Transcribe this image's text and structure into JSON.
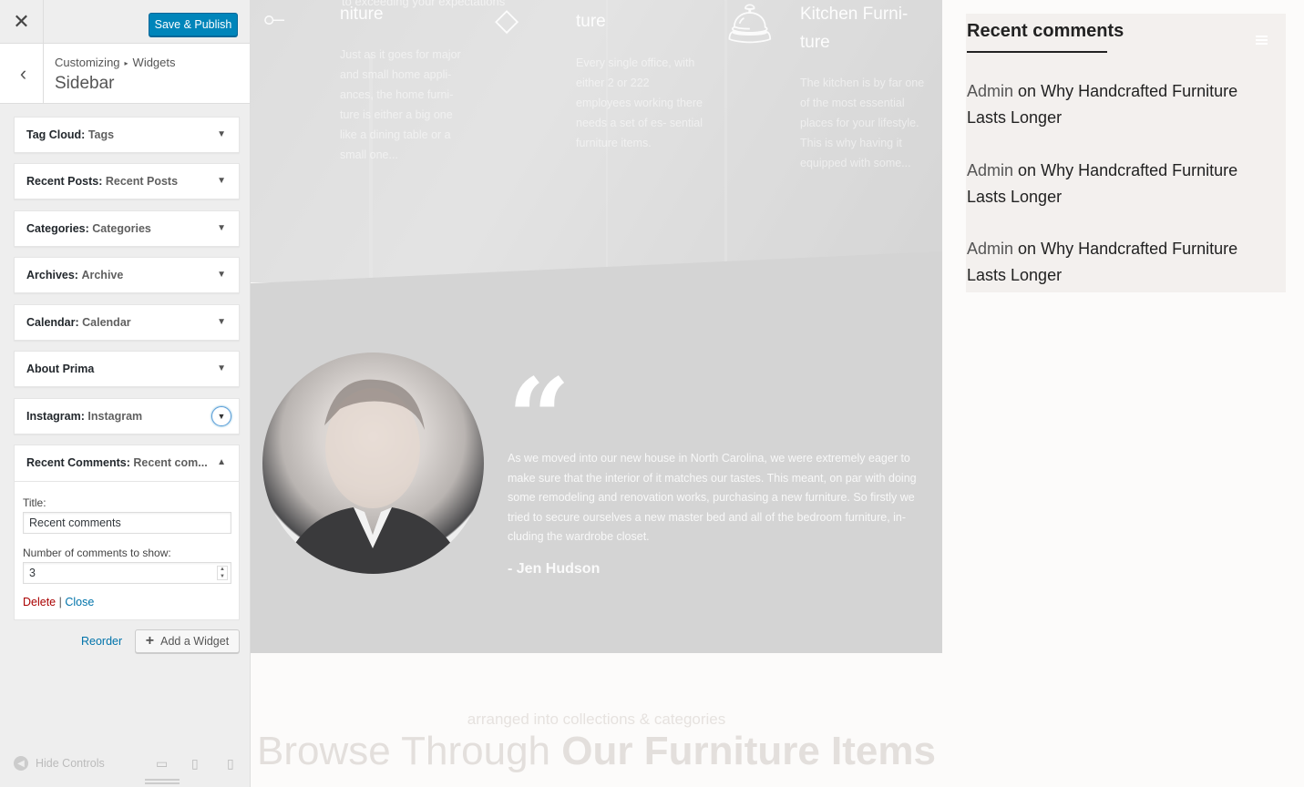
{
  "header": {
    "close_icon": "close-icon",
    "publish_label": "Save & Publish"
  },
  "section": {
    "crumb_root": "Customizing",
    "crumb_sep": "▸",
    "crumb_parent": "Widgets",
    "title": "Sidebar"
  },
  "widgets": [
    {
      "name": "Tag Cloud:",
      "sub": "Tags"
    },
    {
      "name": "Recent Posts:",
      "sub": "Recent Posts"
    },
    {
      "name": "Categories:",
      "sub": "Categories"
    },
    {
      "name": "Archives:",
      "sub": "Archive"
    },
    {
      "name": "Calendar:",
      "sub": "Calendar"
    },
    {
      "name": "About Prima",
      "sub": ""
    },
    {
      "name": "Instagram:",
      "sub": "Instagram"
    }
  ],
  "recent_comments_widget": {
    "name": "Recent Comments:",
    "sub": "Recent com...",
    "title_label": "Title:",
    "title_value": "Recent comments",
    "number_label": "Number of comments to show:",
    "number_value": "3",
    "delete_label": "Delete",
    "divider": "|",
    "close_label": "Close"
  },
  "actions": {
    "reorder_label": "Reorder",
    "add_widget_label": "Add a Widget"
  },
  "footer": {
    "hide_controls_label": "Hide Controls"
  },
  "preview": {
    "features": [
      {
        "title": "niture",
        "text": "Just as it goes for major and small home appli- ances, the home furni- ture is either a big one like a dining table or a small one..."
      },
      {
        "title": "ture",
        "text": "Every single office, with either 2 or 222 employees working there needs a set of es- sential furniture items."
      },
      {
        "title": "Kitchen Furni- ture",
        "text": "The kitchen is by far one of the most essential places for your lifestyle. This is why having it equipped with some..."
      }
    ],
    "hero_top_text": "to exceeding your expectations",
    "testimonial": {
      "quote": "As we moved into our new house in North Carolina, we were extremely eager to make sure that the interior of it matches our tastes. This meant, on par with doing some remodeling and renovation works, purchasing a new furniture. So firstly we tried to secure ourselves a new master bed and all of the bedroom furniture, in- cluding the wardrobe closet.",
      "author": "- Jen Hudson"
    },
    "browse": {
      "subtitle": "arranged into collections & categories",
      "title_light": "Browse Through",
      "title_bold": "Our Furniture Items"
    },
    "recent_comments": {
      "title": "Recent comments",
      "items": [
        {
          "author": "Admin",
          "on": "on",
          "post": "Why Handcrafted Furniture Lasts Longer"
        },
        {
          "author": "Admin",
          "on": "on",
          "post": "Why Handcrafted Furniture Lasts Longer"
        },
        {
          "author": "Admin",
          "on": "on",
          "post": "Why Handcrafted Furniture Lasts Longer"
        }
      ]
    }
  },
  "colors": {
    "primary_button": "#0085ba",
    "link": "#0073aa",
    "delete": "#aa0000"
  }
}
